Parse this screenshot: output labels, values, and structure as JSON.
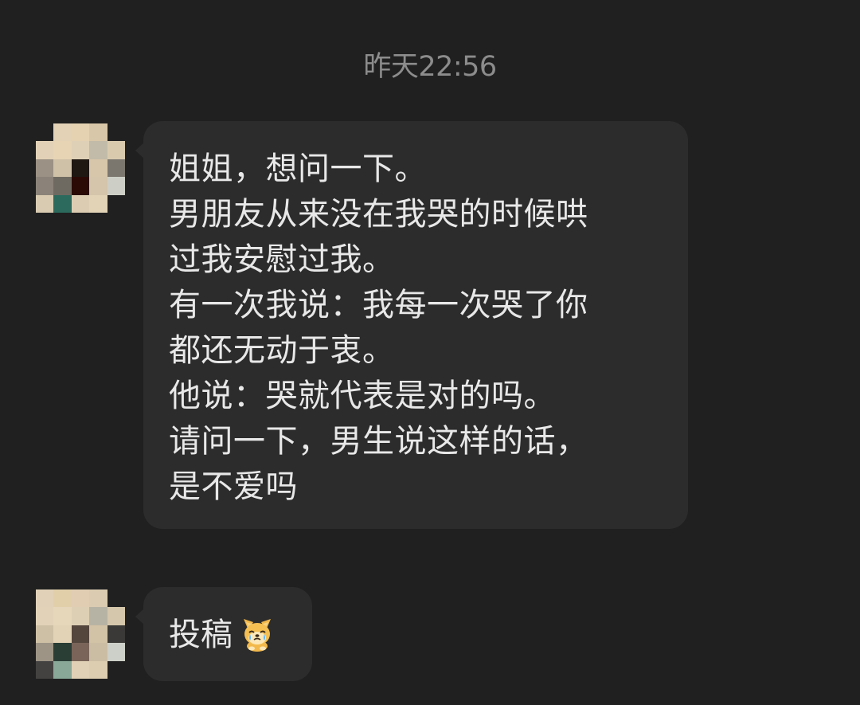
{
  "chat": {
    "timestamp": "昨天22:56",
    "messages": [
      {
        "sender": "other",
        "lines": [
          "姐姐，想问一下。",
          "男朋友从来没在我哭的时候哄",
          "过我安慰过我。",
          "有一次我说：我每一次哭了你",
          "都还无动于衷。",
          "他说：哭就代表是对的吗。",
          "请问一下，男生说这样的话，",
          "是不爱吗"
        ]
      },
      {
        "sender": "other",
        "text": "投稿",
        "emoji": "crying-dog-emoji"
      }
    ]
  },
  "colors": {
    "background": "#202020",
    "bubble": "#2c2c2c",
    "text": "#e8e8e8",
    "timestamp": "#8c8c8c"
  }
}
